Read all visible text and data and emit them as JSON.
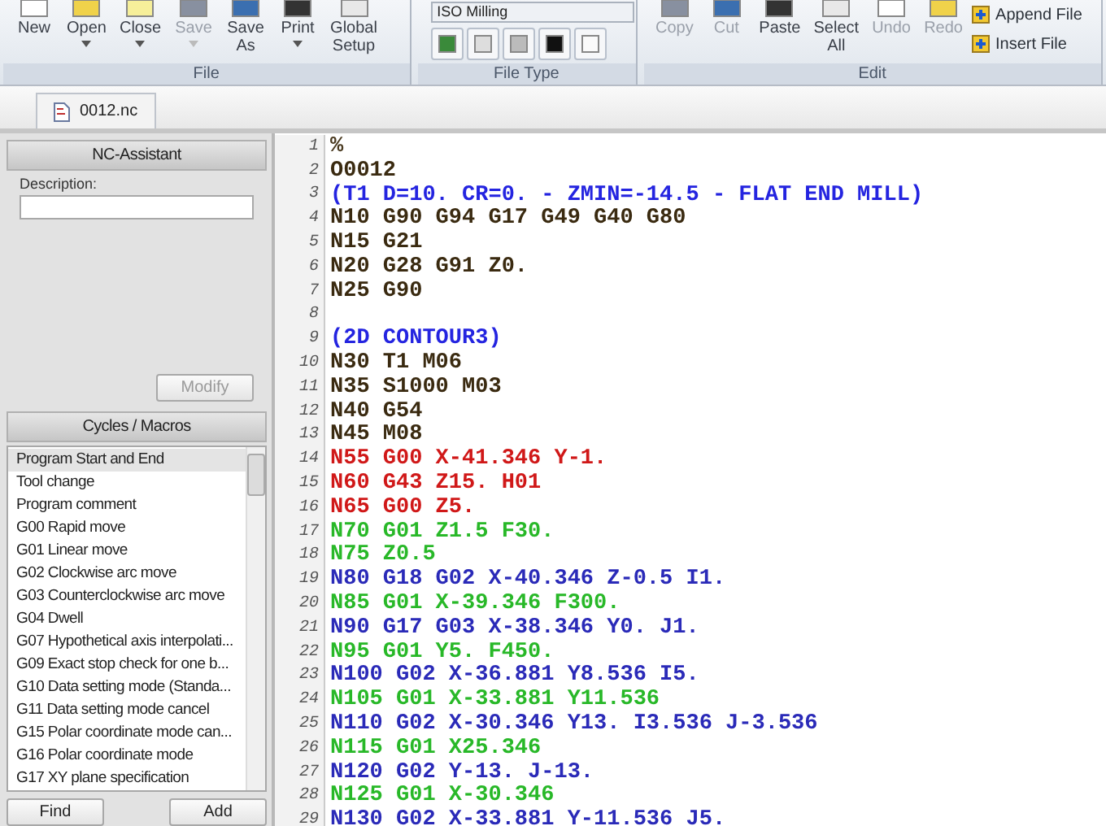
{
  "ribbon": {
    "file_group": {
      "label": "File",
      "buttons": [
        {
          "label": "New",
          "disabled": false,
          "dropdown": false
        },
        {
          "label": "Open",
          "disabled": false,
          "dropdown": true
        },
        {
          "label": "Close",
          "disabled": false,
          "dropdown": true
        },
        {
          "label": "Save",
          "disabled": true,
          "dropdown": true
        },
        {
          "label": "Save As",
          "disabled": false,
          "dropdown": false
        },
        {
          "label": "Print",
          "disabled": false,
          "dropdown": true
        },
        {
          "label": "Global Setup",
          "disabled": false,
          "dropdown": false
        }
      ]
    },
    "file_type_group": {
      "label": "File Type",
      "field": "ISO Milling"
    },
    "edit_group": {
      "label": "Edit",
      "buttons": [
        {
          "label": "Copy",
          "disabled": true,
          "dropdown": false
        },
        {
          "label": "Cut",
          "disabled": true,
          "dropdown": false
        },
        {
          "label": "Paste",
          "disabled": false,
          "dropdown": false
        },
        {
          "label": "Select All",
          "disabled": false,
          "dropdown": false
        },
        {
          "label": "Undo",
          "disabled": true,
          "dropdown": false
        },
        {
          "label": "Redo",
          "disabled": true,
          "dropdown": false
        }
      ],
      "side_buttons": [
        "Append File",
        "Insert File"
      ]
    }
  },
  "tabs": [
    {
      "label": "0012.nc",
      "selected": true
    }
  ],
  "assistant": {
    "title": "NC-Assistant",
    "description_label": "Description:",
    "button": {
      "label": "Modify",
      "disabled": true
    }
  },
  "cycles": {
    "title": "Cycles / Macros",
    "items": [
      {
        "label": "Program Start and End",
        "selected": true
      },
      {
        "label": "Tool change",
        "selected": false
      },
      {
        "label": "Program comment",
        "selected": false
      },
      {
        "label": "G00 Rapid move",
        "selected": false
      },
      {
        "label": "G01 Linear move",
        "selected": false
      },
      {
        "label": "G02 Clockwise arc move",
        "selected": false
      },
      {
        "label": "G03 Counterclockwise arc move",
        "selected": false
      },
      {
        "label": "G04 Dwell",
        "selected": false
      },
      {
        "label": "G07 Hypothetical axis interpolati...",
        "selected": false
      },
      {
        "label": "G09 Exact stop check for one b...",
        "selected": false
      },
      {
        "label": "G10 Data setting mode (Standa...",
        "selected": false
      },
      {
        "label": "G11 Data setting mode cancel",
        "selected": false
      },
      {
        "label": "G15 Polar coordinate mode can...",
        "selected": false
      },
      {
        "label": "G16 Polar coordinate mode",
        "selected": false
      },
      {
        "label": "G17 XY plane specification",
        "selected": false
      }
    ],
    "buttons": [
      "Find",
      "Add"
    ]
  },
  "editor": {
    "lines": [
      {
        "number": "1",
        "text": "%",
        "color": "#4a3a20"
      },
      {
        "number": "2",
        "text": "O0012",
        "color": "#3a2a10"
      },
      {
        "number": "3",
        "text": "(T1 D=10. CR=0. - ZMIN=-14.5 - FLAT END MILL)",
        "color": "#2424e0"
      },
      {
        "number": "4",
        "text": "N10 G90 G94 G17 G49 G40 G80",
        "color": "#3a2a10"
      },
      {
        "number": "5",
        "text": "N15 G21",
        "color": "#3a2a10"
      },
      {
        "number": "6",
        "text": "N20 G28 G91 Z0.",
        "color": "#3a2a10"
      },
      {
        "number": "7",
        "text": "N25 G90",
        "color": "#3a2a10"
      },
      {
        "number": "8"
      },
      {
        "number": "9",
        "text": "(2D CONTOUR3)",
        "color": "#2424e0"
      },
      {
        "number": "10",
        "text": "N30 T1 M06",
        "color": "#3a2a10"
      },
      {
        "number": "11",
        "text": "N35 S1000 M03",
        "color": "#3a2a10"
      },
      {
        "number": "12",
        "text": "N40 G54",
        "color": "#3a2a10"
      },
      {
        "number": "13",
        "text": "N45 M08",
        "color": "#3a2a10"
      },
      {
        "number": "14",
        "text": "N55 G00 X-41.346 Y-1.",
        "color": "#d01818"
      },
      {
        "number": "15",
        "text": "N60 G43 Z15. H01",
        "color": "#d01818"
      },
      {
        "number": "16",
        "text": "N65 G00 Z5.",
        "color": "#d01818"
      },
      {
        "number": "17",
        "text": "N70 G01 Z1.5 F30.",
        "color": "#28b828"
      },
      {
        "number": "18",
        "text": "N75 Z0.5",
        "color": "#28b828"
      },
      {
        "number": "19",
        "text": "N80 G18 G02 X-40.346 Z-0.5 I1.",
        "color": "#2a2ab8"
      },
      {
        "number": "20",
        "text": "N85 G01 X-39.346 F300.",
        "color": "#28b828"
      },
      {
        "number": "21",
        "text": "N90 G17 G03 X-38.346 Y0. J1.",
        "color": "#2a2ab8"
      },
      {
        "number": "22",
        "text": "N95 G01 Y5. F450.",
        "color": "#28b828"
      },
      {
        "number": "23",
        "text": "N100 G02 X-36.881 Y8.536 I5.",
        "color": "#2a2ab8"
      },
      {
        "number": "24",
        "text": "N105 G01 X-33.881 Y11.536",
        "color": "#28b828"
      },
      {
        "number": "25",
        "text": "N110 G02 X-30.346 Y13. I3.536 J-3.536",
        "color": "#2a2ab8"
      },
      {
        "number": "26",
        "text": "N115 G01 X25.346",
        "color": "#28b828"
      },
      {
        "number": "27",
        "text": "N120 G02 Y-13. J-13.",
        "color": "#2a2ab8"
      },
      {
        "number": "28",
        "text": "N125 G01 X-30.346",
        "color": "#28b828"
      },
      {
        "number": "29",
        "text": "N130 G02 X-33.881 Y-11.536 J5.",
        "color": "#2a2ab8"
      }
    ]
  }
}
